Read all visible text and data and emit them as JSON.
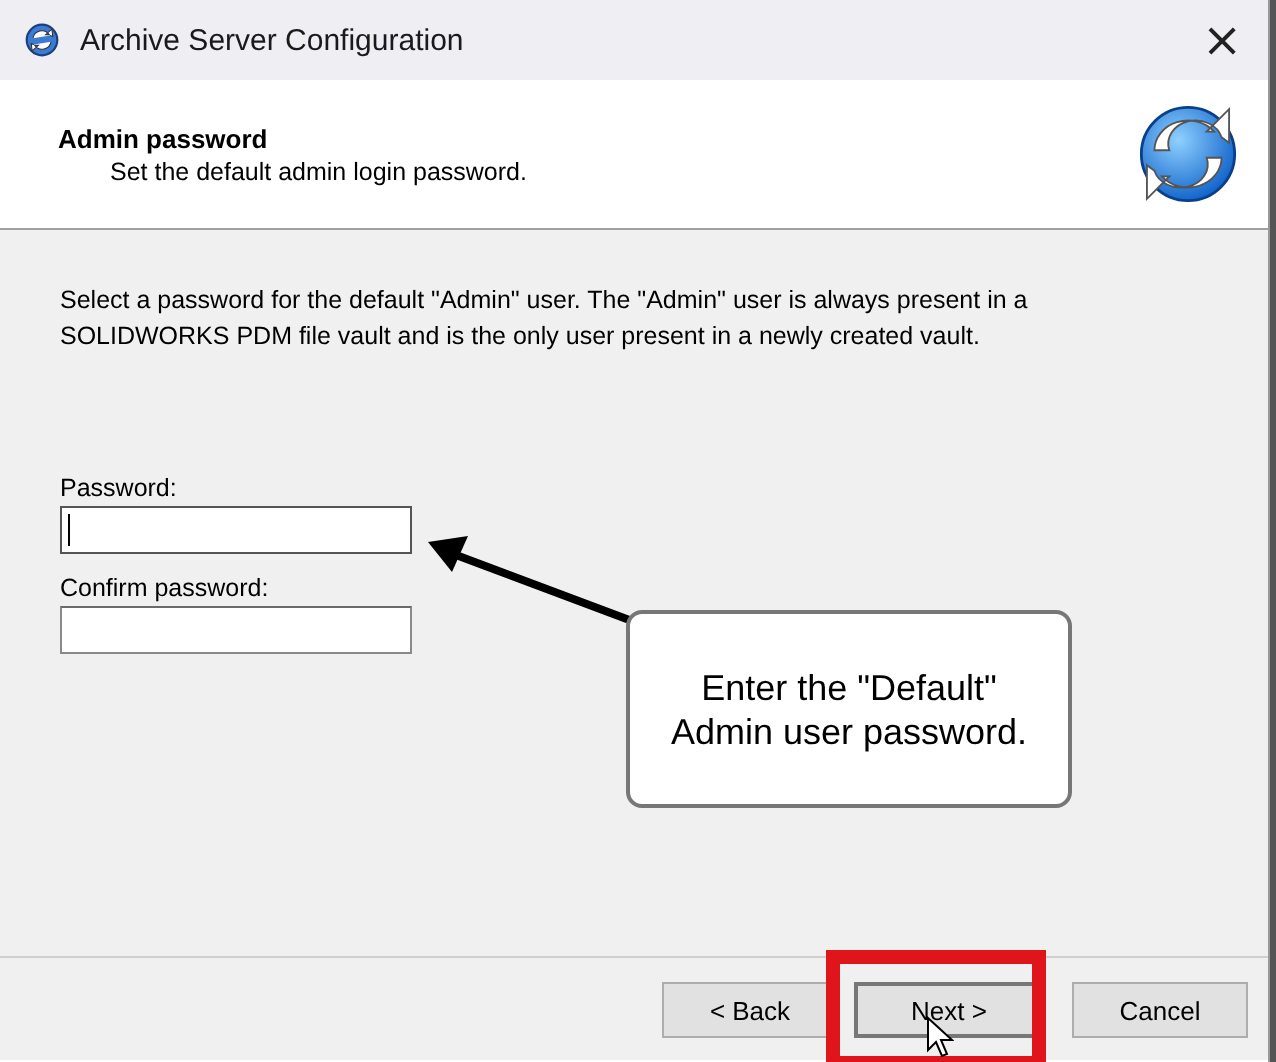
{
  "window": {
    "title": "Archive Server Configuration",
    "close": "×"
  },
  "header": {
    "title": "Admin password",
    "subtitle": "Set the default admin login password."
  },
  "description": "Select a password for the default \"Admin\" user. The \"Admin\" user is always present in a SOLIDWORKS PDM file vault and is the only user present in a newly created vault.",
  "fields": [
    {
      "label": "Password:",
      "focused": true
    },
    {
      "label": "Confirm password:",
      "focused": false
    }
  ],
  "buttons": [
    {
      "label": "< Back",
      "highlighted": false
    },
    {
      "label": "Next >",
      "highlighted": true
    },
    {
      "label": "Cancel",
      "highlighted": false
    }
  ],
  "callout": {
    "text": "Enter the \"Default\" Admin user password."
  }
}
